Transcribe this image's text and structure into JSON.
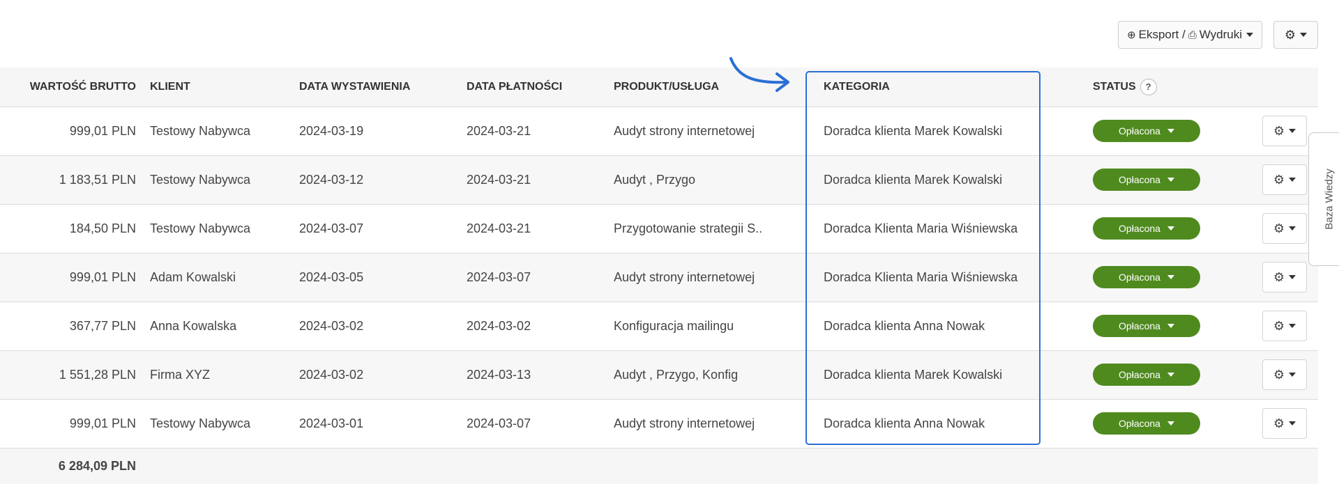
{
  "toolbar": {
    "export_label": "Eksport / ",
    "print_label": "Wydruki"
  },
  "columns": {
    "amount": "WARTOŚĆ BRUTTO",
    "client": "KLIENT",
    "issue_date": "DATA WYSTAWIENIA",
    "payment_date": "DATA PŁATNOŚCI",
    "product": "PRODUKT/USŁUGA",
    "category": "KATEGORIA",
    "status": "STATUS",
    "status_help": "?"
  },
  "rows": [
    {
      "amount": "999,01 PLN",
      "client": "Testowy Nabywca",
      "issue_date": "2024-03-19",
      "payment_date": "2024-03-21",
      "product": "Audyt strony internetowej",
      "category": "Doradca klienta Marek Kowalski",
      "status": "Opłacona"
    },
    {
      "amount": "1 183,51 PLN",
      "client": "Testowy Nabywca",
      "issue_date": "2024-03-12",
      "payment_date": "2024-03-21",
      "product": "Audyt , Przygo",
      "category": "Doradca klienta Marek Kowalski",
      "status": "Opłacona"
    },
    {
      "amount": "184,50 PLN",
      "client": "Testowy Nabywca",
      "issue_date": "2024-03-07",
      "payment_date": "2024-03-21",
      "product": "Przygotowanie strategii S..",
      "category": "Doradca Klienta Maria Wiśniewska",
      "status": "Opłacona"
    },
    {
      "amount": "999,01 PLN",
      "client": "Adam Kowalski",
      "issue_date": "2024-03-05",
      "payment_date": "2024-03-07",
      "product": "Audyt strony internetowej",
      "category": "Doradca Klienta Maria Wiśniewska",
      "status": "Opłacona"
    },
    {
      "amount": "367,77 PLN",
      "client": "Anna Kowalska",
      "issue_date": "2024-03-02",
      "payment_date": "2024-03-02",
      "product": "Konfiguracja mailingu",
      "category": "Doradca klienta Anna Nowak",
      "status": "Opłacona"
    },
    {
      "amount": "1 551,28 PLN",
      "client": "Firma XYZ",
      "issue_date": "2024-03-02",
      "payment_date": "2024-03-13",
      "product": "Audyt , Przygo, Konfig",
      "category": "Doradca klienta Marek Kowalski",
      "status": "Opłacona"
    },
    {
      "amount": "999,01 PLN",
      "client": "Testowy Nabywca",
      "issue_date": "2024-03-01",
      "payment_date": "2024-03-07",
      "product": "Audyt strony internetowej",
      "category": "Doradca klienta Anna Nowak",
      "status": "Opłacona"
    }
  ],
  "total": "6 284,09 PLN",
  "side_tab": "Baza Wiedzy",
  "colors": {
    "status_paid": "#4f8a1f",
    "highlight": "#2a6fd6"
  },
  "icons": [
    "download-circle-icon",
    "printer-icon",
    "gear-icon",
    "chevron-down-icon",
    "help-icon",
    "arrow-icon"
  ]
}
